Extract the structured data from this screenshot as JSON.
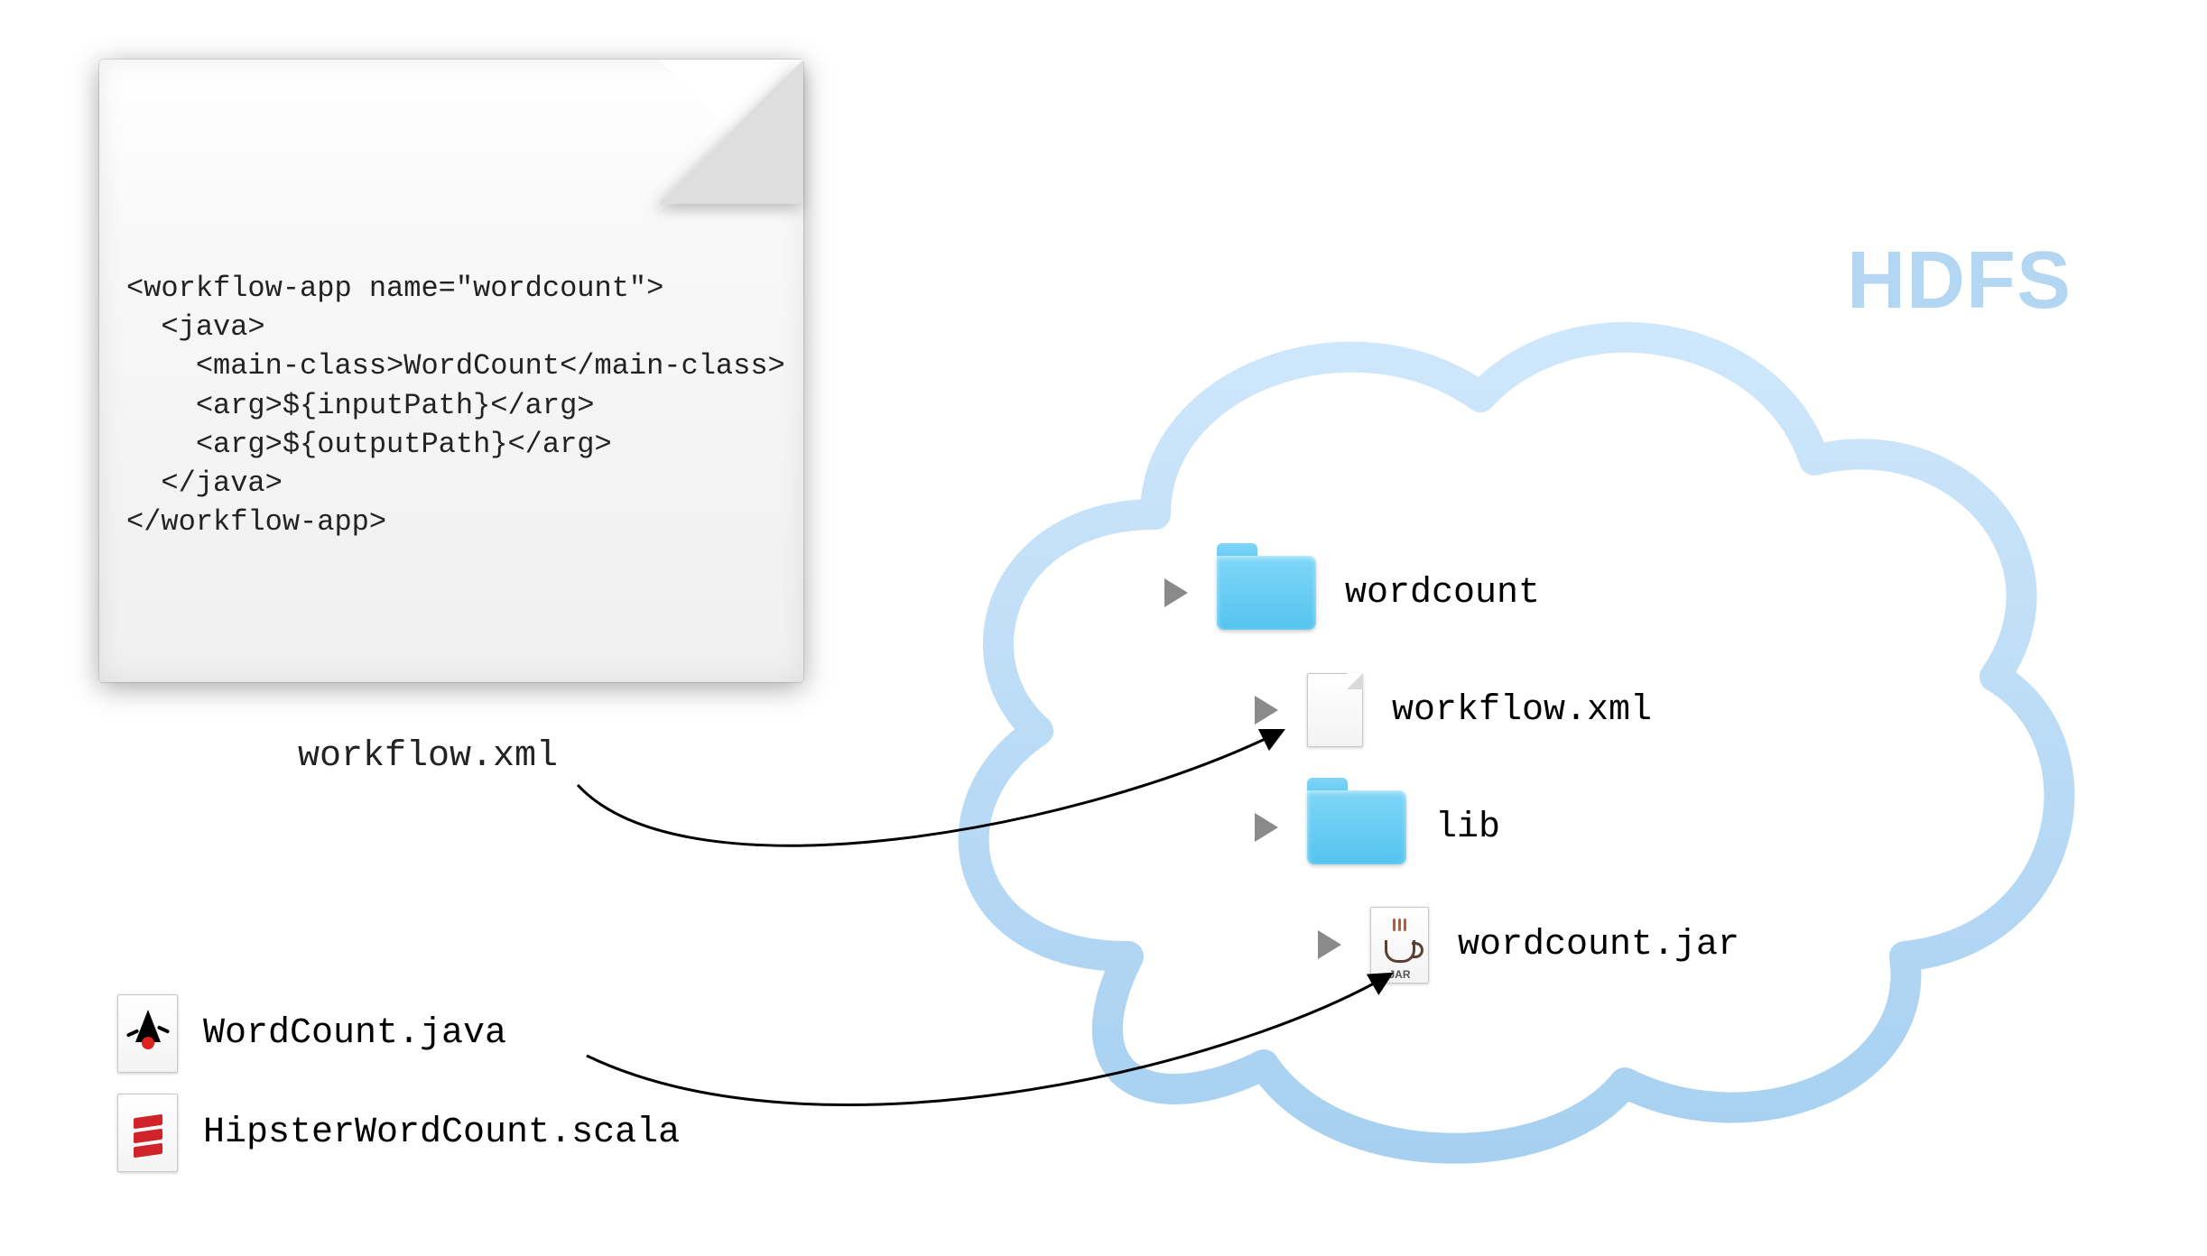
{
  "cloud": {
    "title": "HDFS"
  },
  "document": {
    "label": "workflow.xml",
    "code": "<workflow-app name=\"wordcount\">\n  <java>\n    <main-class>WordCount</main-class>\n    <arg>${inputPath}</arg>\n    <arg>${outputPath}</arg>\n  </java>\n</workflow-app>"
  },
  "source_files": [
    {
      "icon": "java",
      "name": "WordCount.java"
    },
    {
      "icon": "scala",
      "name": "HipsterWordCount.scala"
    }
  ],
  "hdfs_tree": [
    {
      "level": 0,
      "icon": "folder",
      "name": "wordcount"
    },
    {
      "level": 1,
      "icon": "file",
      "name": "workflow.xml"
    },
    {
      "level": 1,
      "icon": "folder",
      "name": "lib"
    },
    {
      "level": 2,
      "icon": "jar",
      "name": "wordcount.jar"
    },
    {
      "slot": "jar_label",
      "value": "JAR"
    }
  ],
  "arrows": [
    {
      "from": "workflow.xml (local)",
      "to": "workflow.xml (HDFS)"
    },
    {
      "from": "source files",
      "to": "wordcount.jar (HDFS)"
    }
  ]
}
